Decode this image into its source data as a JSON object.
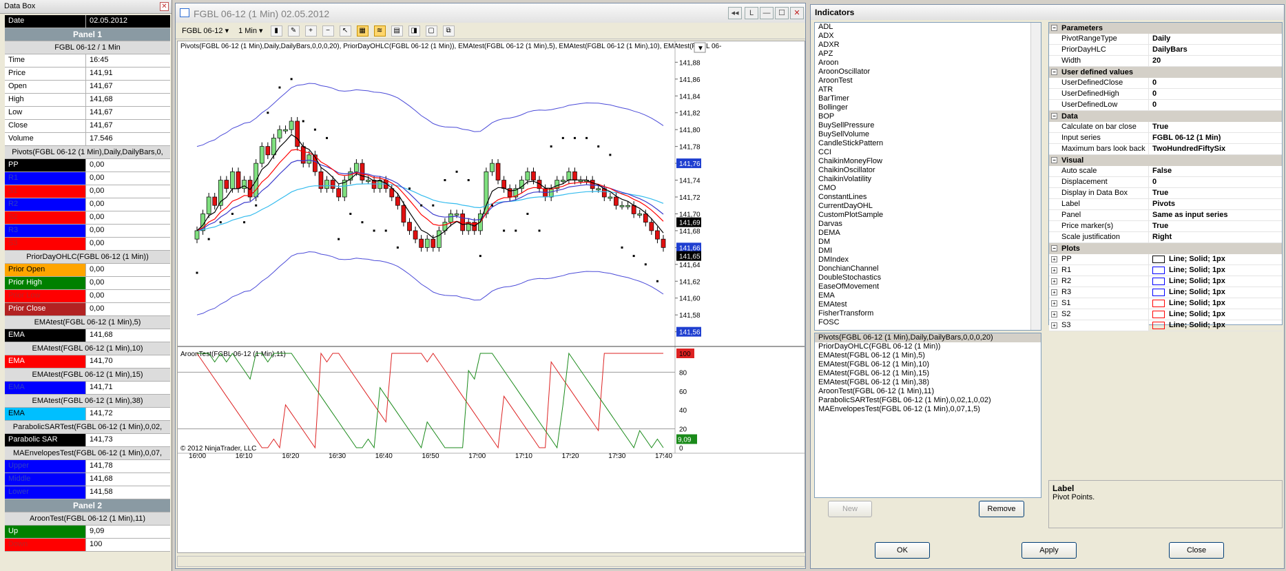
{
  "databox": {
    "title": "Data Box",
    "date_label": "Date",
    "date_value": "02.05.2012",
    "panel1": "Panel 1",
    "instrument": "FGBL 06-12 / 1 Min",
    "bars": [
      {
        "k": "Time",
        "v": "16:45"
      },
      {
        "k": "Price",
        "v": "141,91"
      },
      {
        "k": "Open",
        "v": "141,67"
      },
      {
        "k": "High",
        "v": "141,68"
      },
      {
        "k": "Low",
        "v": "141,67"
      },
      {
        "k": "Close",
        "v": "141,67"
      },
      {
        "k": "Volume",
        "v": "17.546"
      }
    ],
    "pivots_hdr": "Pivots(FGBL 06-12 (1 Min),Daily,DailyBars,0,",
    "pivots": [
      {
        "k": "PP",
        "v": "0,00",
        "bg": "#000000",
        "fg": "#ffffff"
      },
      {
        "k": "R1",
        "v": "0,00",
        "bg": "#0000ff",
        "fg": "#3040c0"
      },
      {
        "k": "S1",
        "v": "0,00",
        "bg": "#ff0000",
        "fg": "#c02020"
      },
      {
        "k": "R2",
        "v": "0,00",
        "bg": "#0000ff",
        "fg": "#3040c0"
      },
      {
        "k": "S2",
        "v": "0,00",
        "bg": "#ff0000",
        "fg": "#c02020"
      },
      {
        "k": "R3",
        "v": "0,00",
        "bg": "#0000ff",
        "fg": "#3040c0"
      },
      {
        "k": "S3",
        "v": "0,00",
        "bg": "#ff0000",
        "fg": "#c02020"
      }
    ],
    "prior_hdr": "PriorDayOHLC(FGBL 06-12 (1 Min))",
    "prior": [
      {
        "k": "Prior Open",
        "v": "0,00",
        "bg": "#ffa500",
        "fg": "#000000"
      },
      {
        "k": "Prior High",
        "v": "0,00",
        "bg": "#008000",
        "fg": "#ffffff"
      },
      {
        "k": "Prior Low",
        "v": "0,00",
        "bg": "#ff0000",
        "fg": "#c02020"
      },
      {
        "k": "Prior Close",
        "v": "0,00",
        "bg": "#b22222",
        "fg": "#ffffff"
      }
    ],
    "ema5_hdr": "EMAtest(FGBL 06-12 (1 Min),5)",
    "ema5": {
      "k": "EMA",
      "v": "141,68",
      "bg": "#000000",
      "fg": "#ffffff"
    },
    "ema10_hdr": "EMAtest(FGBL 06-12 (1 Min),10)",
    "ema10": {
      "k": "EMA",
      "v": "141,70",
      "bg": "#ff0000",
      "fg": "#ffffff"
    },
    "ema15_hdr": "EMAtest(FGBL 06-12 (1 Min),15)",
    "ema15": {
      "k": "EMA",
      "v": "141,71",
      "bg": "#0000ff",
      "fg": "#3040c0"
    },
    "ema38_hdr": "EMAtest(FGBL 06-12 (1 Min),38)",
    "ema38": {
      "k": "EMA",
      "v": "141,72",
      "bg": "#00bfff",
      "fg": "#000000"
    },
    "psar_hdr": "ParabolicSARTest(FGBL 06-12 (1 Min),0,02,",
    "psar": {
      "k": "Parabolic SAR",
      "v": "141,73",
      "bg": "#000000",
      "fg": "#ffffff"
    },
    "mae_hdr": "MAEnvelopesTest(FGBL 06-12 (1 Min),0,07,",
    "mae": [
      {
        "k": "Upper",
        "v": "141,78",
        "bg": "#0000ff",
        "fg": "#3040c0"
      },
      {
        "k": "Middle",
        "v": "141,68",
        "bg": "#0000ff",
        "fg": "#3040c0"
      },
      {
        "k": "Lower",
        "v": "141,58",
        "bg": "#0000ff",
        "fg": "#3040c0"
      }
    ],
    "panel2": "Panel 2",
    "aroon_hdr": "AroonTest(FGBL 06-12 (1 Min),11)",
    "aroon": [
      {
        "k": "Up",
        "v": "9,09",
        "bg": "#008000",
        "fg": "#ffffff"
      },
      {
        "k": "Down",
        "v": "100",
        "bg": "#ff0000",
        "fg": "#c02020"
      }
    ]
  },
  "chartwin": {
    "title": "FGBL 06-12 (1 Min)  02.05.2012",
    "instrument_sel": "FGBL 06-12 ▾",
    "period_sel": "1 Min ▾",
    "indicator_label": "Pivots(FGBL 06-12 (1 Min),Daily,DailyBars,0,0,0,20), PriorDayOHLC(FGBL 06-12 (1 Min)), EMAtest(FGBL 06-12 (1 Min),5), EMAtest(FGBL 06-12 (1 Min),10), EMAtest(FGBL 06-",
    "aroon_label": "AroonTest(FGBL 06-12 (1 Min),11)",
    "copyright": "© 2012 NinjaTrader, LLC",
    "window_btns": [
      "◂◂",
      "L",
      "—",
      "☐",
      "✕"
    ]
  },
  "chart_data": {
    "type": "candlestick",
    "price_axis": {
      "ticks": [
        "141,88",
        "141,86",
        "141,84",
        "141,82",
        "141,80",
        "141,78",
        "141,76",
        "141,74",
        "141,72",
        "141,70",
        "141,68",
        "141,66",
        "141,64",
        "141,62",
        "141,60",
        "141,58",
        "141,56"
      ],
      "range": [
        141.545,
        141.895
      ]
    },
    "time_ticks": [
      "16:00",
      "16:10",
      "16:20",
      "16:30",
      "16:40",
      "16:50",
      "17:00",
      "17:10",
      "17:20",
      "17:30",
      "17:40"
    ],
    "price_markers": [
      {
        "label": "141,76",
        "v": 141.76,
        "bg": "#1f3fd0",
        "fg": "#ffffff"
      },
      {
        "label": "141,69",
        "v": 141.69,
        "bg": "#000000",
        "fg": "#ffffff"
      },
      {
        "label": "141,66",
        "v": 141.66,
        "bg": "#1f3fd0",
        "fg": "#ffffff"
      },
      {
        "label": "141,65",
        "v": 141.65,
        "bg": "#000000",
        "fg": "#ffffff"
      },
      {
        "label": "141,56",
        "v": 141.56,
        "bg": "#1f3fd0",
        "fg": "#ffffff"
      }
    ],
    "close": [
      141.68,
      141.7,
      141.72,
      141.71,
      141.74,
      141.73,
      141.75,
      141.73,
      141.74,
      141.72,
      141.76,
      141.78,
      141.77,
      141.79,
      141.8,
      141.8,
      141.81,
      141.78,
      141.76,
      141.77,
      141.75,
      141.73,
      141.74,
      141.73,
      141.72,
      141.74,
      141.75,
      141.76,
      141.74,
      141.74,
      141.73,
      141.74,
      141.73,
      141.72,
      141.71,
      141.69,
      141.68,
      141.67,
      141.66,
      141.67,
      141.66,
      141.68,
      141.69,
      141.7,
      141.7,
      141.68,
      141.69,
      141.68,
      141.7,
      141.75,
      141.76,
      141.74,
      141.73,
      141.72,
      141.73,
      141.74,
      141.75,
      141.74,
      141.73,
      141.72,
      141.73,
      141.74,
      141.74,
      141.75,
      141.74,
      141.74,
      141.74,
      141.73,
      141.73,
      141.72,
      141.72,
      141.71,
      141.71,
      141.71,
      141.7,
      141.7,
      141.69,
      141.68,
      141.67,
      141.66
    ],
    "ema_fast": "#000000",
    "ema10": "#ff0000",
    "ema15": "#3b3bcc",
    "ema38": "#33bbee",
    "aroon": {
      "ticks": [
        "100",
        "80",
        "60",
        "40",
        "20",
        "0"
      ],
      "up_label": "9,09",
      "down_label": "100",
      "up_color": "#1a8a1a",
      "down_color": "#dd2222"
    }
  },
  "indicators": {
    "title": "Indicators",
    "list": [
      "ADL",
      "ADX",
      "ADXR",
      "APZ",
      "Aroon",
      "AroonOscillator",
      "AroonTest",
      "ATR",
      "BarTimer",
      "Bollinger",
      "BOP",
      "BuySellPressure",
      "BuySellVolume",
      "CandleStickPattern",
      "CCI",
      "ChaikinMoneyFlow",
      "ChaikinOscillator",
      "ChaikinVolatility",
      "CMO",
      "ConstantLines",
      "CurrentDayOHL",
      "CustomPlotSample",
      "Darvas",
      "DEMA",
      "DM",
      "DMI",
      "DMIndex",
      "DonchianChannel",
      "DoubleStochastics",
      "EaseOfMovement",
      "EMA",
      "EMAtest",
      "FisherTransform",
      "FOSC"
    ],
    "applied": [
      "Pivots(FGBL 06-12 (1 Min),Daily,DailyBars,0,0,0,20)",
      "PriorDayOHLC(FGBL 06-12 (1 Min))",
      "EMAtest(FGBL 06-12 (1 Min),5)",
      "EMAtest(FGBL 06-12 (1 Min),10)",
      "EMAtest(FGBL 06-12 (1 Min),15)",
      "EMAtest(FGBL 06-12 (1 Min),38)",
      "AroonTest(FGBL 06-12 (1 Min),11)",
      "ParabolicSARTest(FGBL 06-12 (1 Min),0,02,1,0,02)",
      "MAEnvelopesTest(FGBL 06-12 (1 Min),0,07,1,5)"
    ],
    "new_btn": "New",
    "remove_btn": "Remove",
    "ok_btn": "OK",
    "apply_btn": "Apply",
    "close_btn": "Close",
    "props": [
      {
        "cat": "Parameters",
        "rows": [
          {
            "k": "PivotRangeType",
            "v": "Daily"
          },
          {
            "k": "PriorDayHLC",
            "v": "DailyBars"
          },
          {
            "k": "Width",
            "v": "20"
          }
        ]
      },
      {
        "cat": "User defined values",
        "rows": [
          {
            "k": "UserDefinedClose",
            "v": "0"
          },
          {
            "k": "UserDefinedHigh",
            "v": "0"
          },
          {
            "k": "UserDefinedLow",
            "v": "0"
          }
        ]
      },
      {
        "cat": "Data",
        "rows": [
          {
            "k": "Calculate on bar close",
            "v": "True"
          },
          {
            "k": "Input series",
            "v": "FGBL 06-12 (1 Min)"
          },
          {
            "k": "Maximum bars look back",
            "v": "TwoHundredFiftySix"
          }
        ]
      },
      {
        "cat": "Visual",
        "rows": [
          {
            "k": "Auto scale",
            "v": "False"
          },
          {
            "k": "Displacement",
            "v": "0"
          },
          {
            "k": "Display in Data Box",
            "v": "True"
          },
          {
            "k": "Label",
            "v": "Pivots"
          },
          {
            "k": "Panel",
            "v": "Same as input series"
          },
          {
            "k": "Price marker(s)",
            "v": "True"
          },
          {
            "k": "Scale justification",
            "v": "Right"
          }
        ]
      },
      {
        "cat": "Plots",
        "rows": [
          {
            "k": "PP",
            "v": "Line; Solid; 1px",
            "sw": "#000000"
          },
          {
            "k": "R1",
            "v": "Line; Solid; 1px",
            "sw": "#0000ff"
          },
          {
            "k": "R2",
            "v": "Line; Solid; 1px",
            "sw": "#0000ff"
          },
          {
            "k": "R3",
            "v": "Line; Solid; 1px",
            "sw": "#0000ff"
          },
          {
            "k": "S1",
            "v": "Line; Solid; 1px",
            "sw": "#ff0000"
          },
          {
            "k": "S2",
            "v": "Line; Solid; 1px",
            "sw": "#ff0000"
          },
          {
            "k": "S3",
            "v": "Line; Solid; 1px",
            "sw": "#ff0000"
          }
        ]
      }
    ],
    "desc_title": "Label",
    "desc_text": "Pivot Points."
  }
}
